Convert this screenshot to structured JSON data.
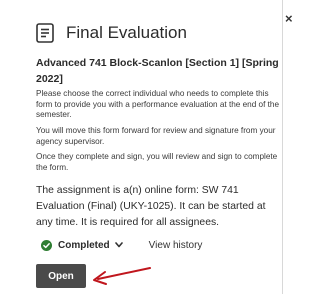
{
  "header": {
    "title": "Final Evaluation",
    "title_icon": "document-icon",
    "close_label": "×"
  },
  "course": {
    "name": "Advanced 741 Block-Scanlon [Section 1] [Spring 2022]"
  },
  "instructions": [
    "Please choose the correct individual who needs to complete this form to provide you with a performance evaluation at the end of the semester.",
    "You will move this form forward for review and signature from your agency supervisor.",
    "Once they complete and sign, you will review and sign to complete the form."
  ],
  "assignment": {
    "text": "The assignment is a(n) online form: SW 741 Evaluation (Final) (UKY-1025). It can be started at any time. It is required for all assignees."
  },
  "status": {
    "label": "Completed",
    "icon": "check-circle-icon",
    "color": "#2e7d32",
    "history_label": "View history"
  },
  "actions": {
    "open_label": "Open"
  },
  "annotation": {
    "arrow_color": "#c0161d"
  }
}
